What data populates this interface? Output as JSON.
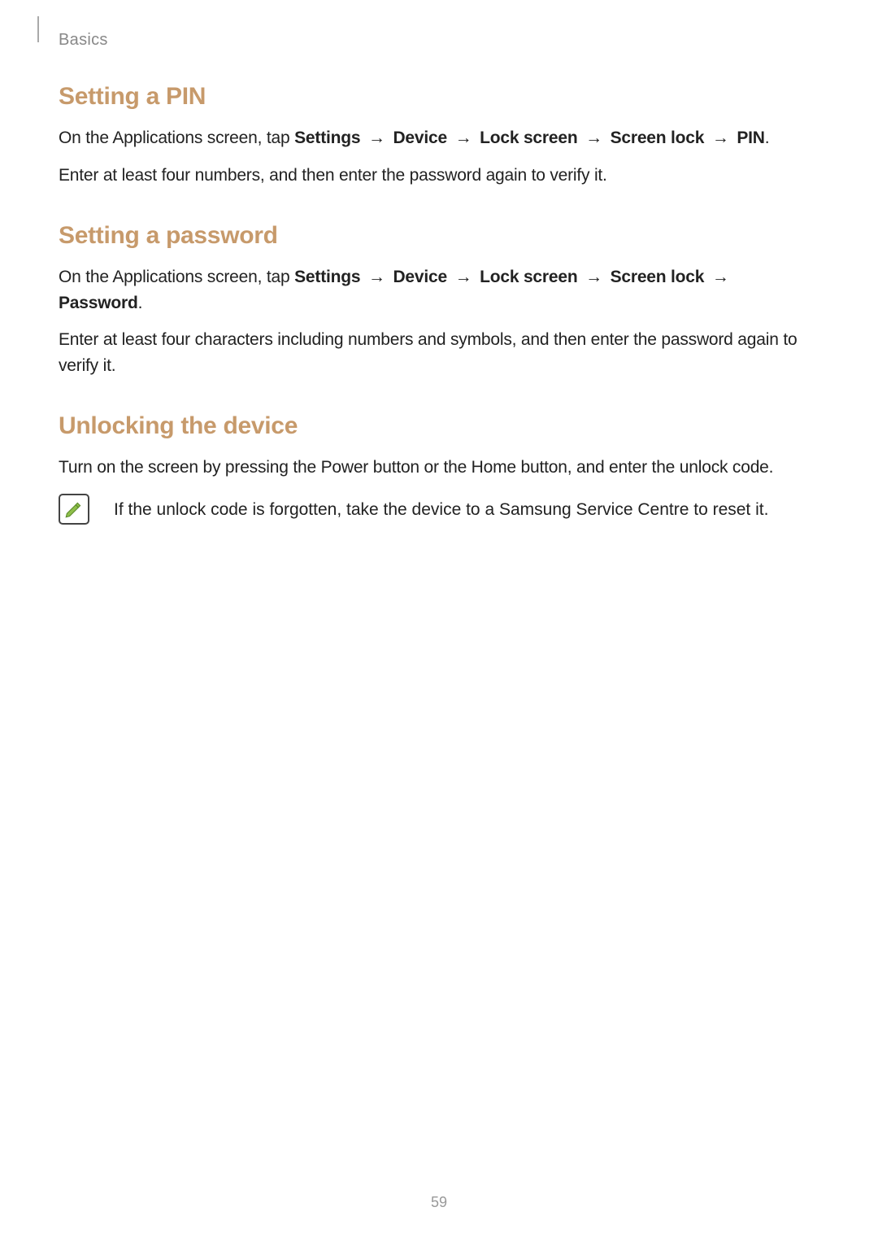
{
  "header": {
    "breadcrumb": "Basics"
  },
  "sections": {
    "pin": {
      "heading": "Setting a PIN",
      "p1_prefix": "On the Applications screen, tap ",
      "path": [
        "Settings",
        "Device",
        "Lock screen",
        "Screen lock",
        "PIN"
      ],
      "p1_suffix": ".",
      "p2": "Enter at least four numbers, and then enter the password again to verify it."
    },
    "password": {
      "heading": "Setting a password",
      "p1_prefix": "On the Applications screen, tap ",
      "path": [
        "Settings",
        "Device",
        "Lock screen",
        "Screen lock",
        "Password"
      ],
      "p1_suffix": ".",
      "p2": "Enter at least four characters including numbers and symbols, and then enter the password again to verify it."
    },
    "unlock": {
      "heading": "Unlocking the device",
      "p1": "Turn on the screen by pressing the Power button or the Home button, and enter the unlock code.",
      "note": "If the unlock code is forgotten, take the device to a Samsung Service Centre to reset it."
    }
  },
  "arrow_glyph": "→",
  "page_number": "59",
  "icons": {
    "note": "note-icon"
  }
}
